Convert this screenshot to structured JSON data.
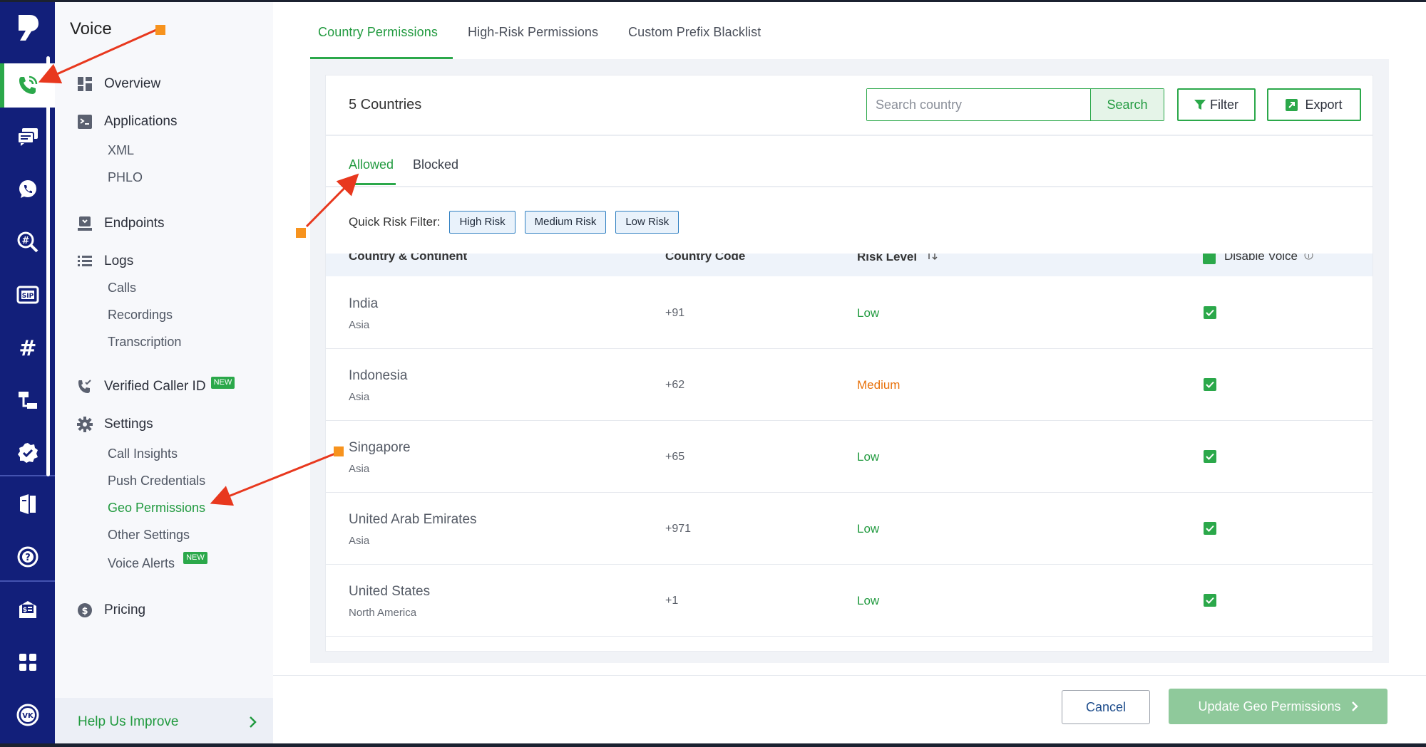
{
  "app": {
    "section_title": "Voice"
  },
  "rail": {
    "items": [
      {
        "icon": "logo-icon"
      },
      {
        "icon": "voice-phone-icon",
        "active": true
      },
      {
        "icon": "messaging-icon"
      },
      {
        "icon": "whatsapp-icon"
      },
      {
        "icon": "number-lookup-icon"
      },
      {
        "icon": "sip-trunking-icon"
      },
      {
        "icon": "phone-numbers-icon"
      },
      {
        "icon": "phlo-flow-icon"
      },
      {
        "icon": "verified-badge-icon"
      },
      {
        "icon": "documentation-icon"
      },
      {
        "icon": "help-icon"
      },
      {
        "icon": "billing-icon"
      },
      {
        "icon": "apps-grid-icon"
      }
    ],
    "avatar_initials": "VK"
  },
  "subnav": {
    "overview": "Overview",
    "applications": "Applications",
    "xml": "XML",
    "phlo": "PHLO",
    "endpoints": "Endpoints",
    "logs": "Logs",
    "calls": "Calls",
    "recordings": "Recordings",
    "transcription": "Transcription",
    "verified_caller_id": "Verified Caller ID",
    "new_badge": "NEW",
    "settings": "Settings",
    "call_insights": "Call Insights",
    "push_credentials": "Push Credentials",
    "geo_permissions": "Geo Permissions",
    "other_settings": "Other Settings",
    "voice_alerts": "Voice Alerts",
    "pricing": "Pricing",
    "help_improve": "Help Us Improve"
  },
  "tabs": {
    "country_permissions": "Country Permissions",
    "high_risk_permissions": "High-Risk Permissions",
    "custom_prefix_blacklist": "Custom Prefix Blacklist"
  },
  "toolbar": {
    "count_title": "5 Countries",
    "search_placeholder": "Search country",
    "search_label": "Search",
    "filter_label": "Filter",
    "export_label": "Export"
  },
  "subtabs": {
    "allowed": "Allowed",
    "blocked": "Blocked"
  },
  "quick_filter": {
    "label": "Quick Risk Filter:",
    "chips": [
      "High Risk",
      "Medium Risk",
      "Low Risk"
    ]
  },
  "table": {
    "headers": {
      "country": "Country & Continent",
      "code": "Country Code",
      "risk": "Risk Level",
      "disable": "Disable Voice"
    },
    "rows": [
      {
        "country": "India",
        "continent": "Asia",
        "code": "+91",
        "risk": "Low",
        "disabled": true
      },
      {
        "country": "Indonesia",
        "continent": "Asia",
        "code": "+62",
        "risk": "Medium",
        "disabled": true
      },
      {
        "country": "Singapore",
        "continent": "Asia",
        "code": "+65",
        "risk": "Low",
        "disabled": true
      },
      {
        "country": "United Arab Emirates",
        "continent": "Asia",
        "code": "+971",
        "risk": "Low",
        "disabled": true
      },
      {
        "country": "United States",
        "continent": "North America",
        "code": "+1",
        "risk": "Low",
        "disabled": true
      }
    ]
  },
  "footer": {
    "cancel_label": "Cancel",
    "update_label": "Update Geo Permissions"
  },
  "colors": {
    "rail": "#121f7a",
    "accent_green": "#2ba84a",
    "risk_low": "#219a3f",
    "risk_medium": "#e8720c",
    "annotation_arrow": "#e8381e",
    "annotation_marker": "#f7931e"
  }
}
